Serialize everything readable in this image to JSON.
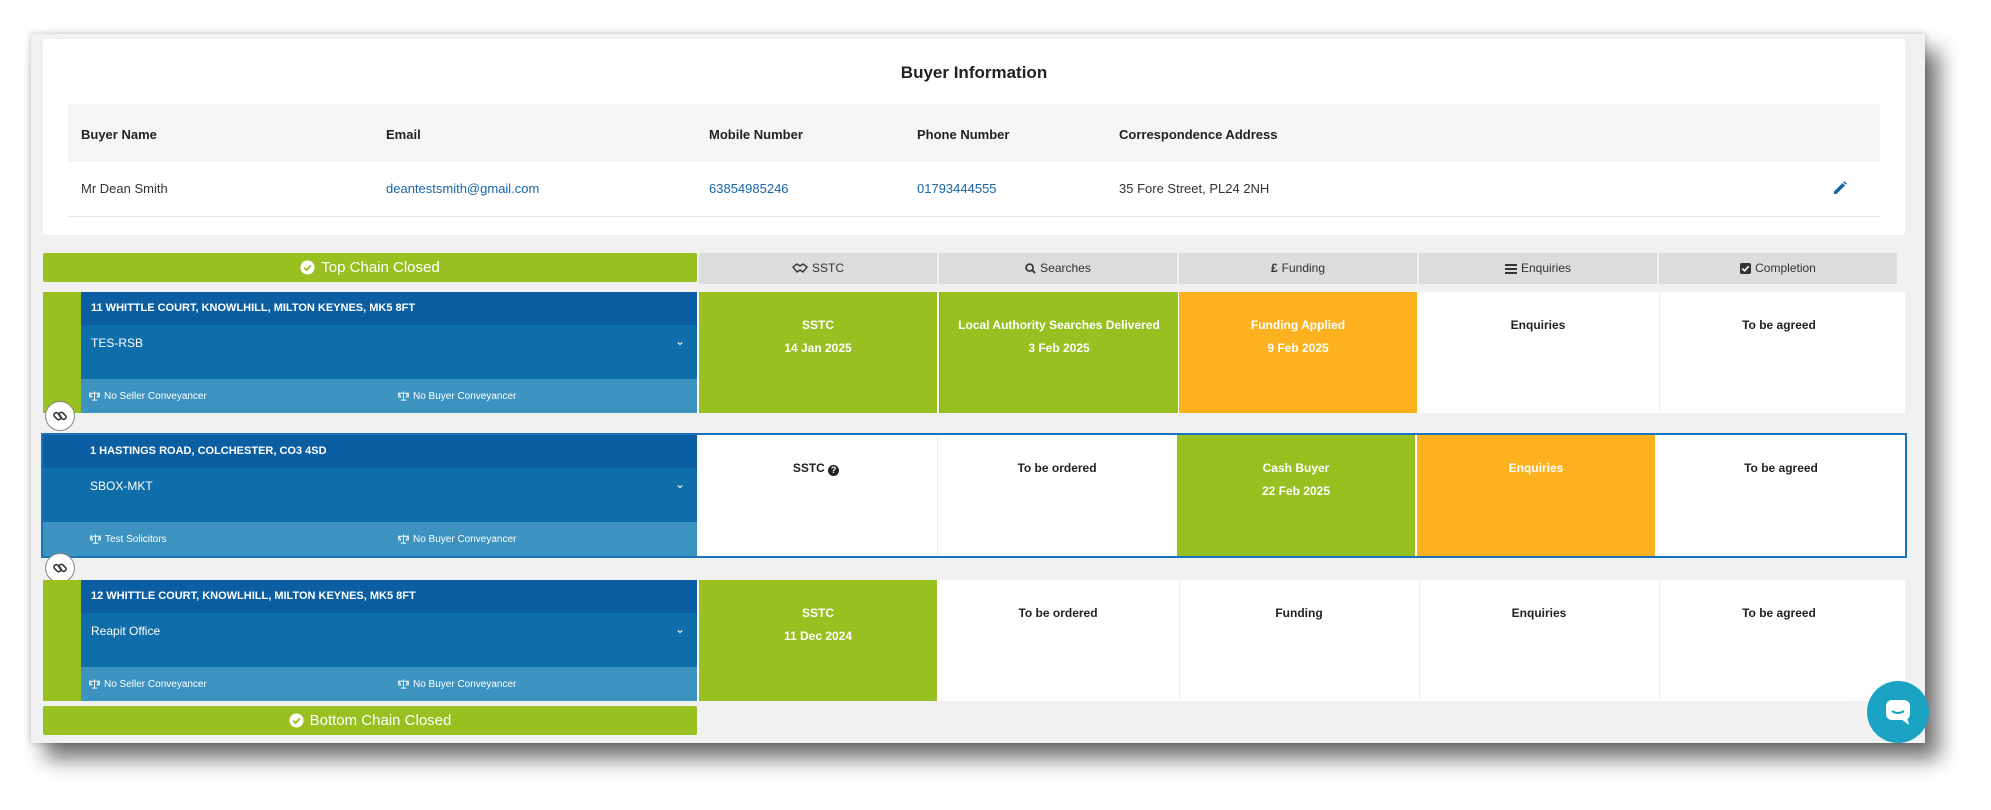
{
  "buyer_info": {
    "title": "Buyer Information",
    "columns": [
      "Buyer Name",
      "Email",
      "Mobile Number",
      "Phone Number",
      "Correspondence Address"
    ],
    "row": {
      "name": "Mr Dean Smith",
      "email": "deantestsmith@gmail.com",
      "mobile": "63854985246",
      "phone": "01793444555",
      "address": "35 Fore Street, PL24 2NH"
    },
    "edit_icon": "pencil-icon"
  },
  "chain": {
    "top_label": "Top Chain Closed",
    "bottom_label": "Bottom Chain Closed",
    "stage_headers": [
      {
        "label": "SSTC",
        "icon": "handshake-icon"
      },
      {
        "label": "Searches",
        "icon": "search-icon"
      },
      {
        "label": "Funding",
        "icon": "pound-icon"
      },
      {
        "label": "Enquiries",
        "icon": "list-icon"
      },
      {
        "label": "Completion",
        "icon": "checkbox-icon"
      }
    ],
    "properties": [
      {
        "address": "11 WHITTLE COURT, KNOWLHILL, MILTON KEYNES, MK5 8FT",
        "office": "TES-RSB",
        "seller_conveyancer": "No Seller Conveyancer",
        "buyer_conveyancer": "No Buyer Conveyancer",
        "stages": [
          {
            "line1": "SSTC",
            "line2": "14 Jan 2025",
            "status": "green"
          },
          {
            "line1": "Local Authority Searches Delivered",
            "line2": "3 Feb 2025",
            "status": "green"
          },
          {
            "line1": "Funding Applied",
            "line2": "9 Feb 2025",
            "status": "orange"
          },
          {
            "line1": "Enquiries",
            "line2": "",
            "status": "white"
          },
          {
            "line1": "To be agreed",
            "line2": "",
            "status": "white"
          }
        ]
      },
      {
        "address": "1 HASTINGS ROAD, COLCHESTER, CO3 4SD",
        "office": "SBOX-MKT",
        "seller_conveyancer": "Test Solicitors",
        "buyer_conveyancer": "No Buyer Conveyancer",
        "stages": [
          {
            "line1": "SSTC",
            "line2": "",
            "status": "white"
          },
          {
            "line1": "To be ordered",
            "line2": "",
            "status": "white"
          },
          {
            "line1": "Cash Buyer",
            "line2": "22 Feb 2025",
            "status": "green"
          },
          {
            "line1": "Enquiries",
            "line2": "",
            "status": "orange"
          },
          {
            "line1": "To be agreed",
            "line2": "",
            "status": "white"
          }
        ]
      },
      {
        "address": "12 WHITTLE COURT, KNOWLHILL, MILTON KEYNES, MK5 8FT",
        "office": "Reapit Office",
        "seller_conveyancer": "No Seller Conveyancer",
        "buyer_conveyancer": "No Buyer Conveyancer",
        "stages": [
          {
            "line1": "SSTC",
            "line2": "11 Dec 2024",
            "status": "green"
          },
          {
            "line1": "To be ordered",
            "line2": "",
            "status": "white"
          },
          {
            "line1": "Funding",
            "line2": "",
            "status": "white"
          },
          {
            "line1": "Enquiries",
            "line2": "",
            "status": "white"
          },
          {
            "line1": "To be agreed",
            "line2": "",
            "status": "white"
          }
        ]
      }
    ]
  },
  "colors": {
    "green": "#97c020",
    "orange": "#fbb21e",
    "blue_dark": "#0b5ea2",
    "blue": "#0f6ea9",
    "blue_light": "#3c93c0",
    "link": "#1565a8"
  }
}
